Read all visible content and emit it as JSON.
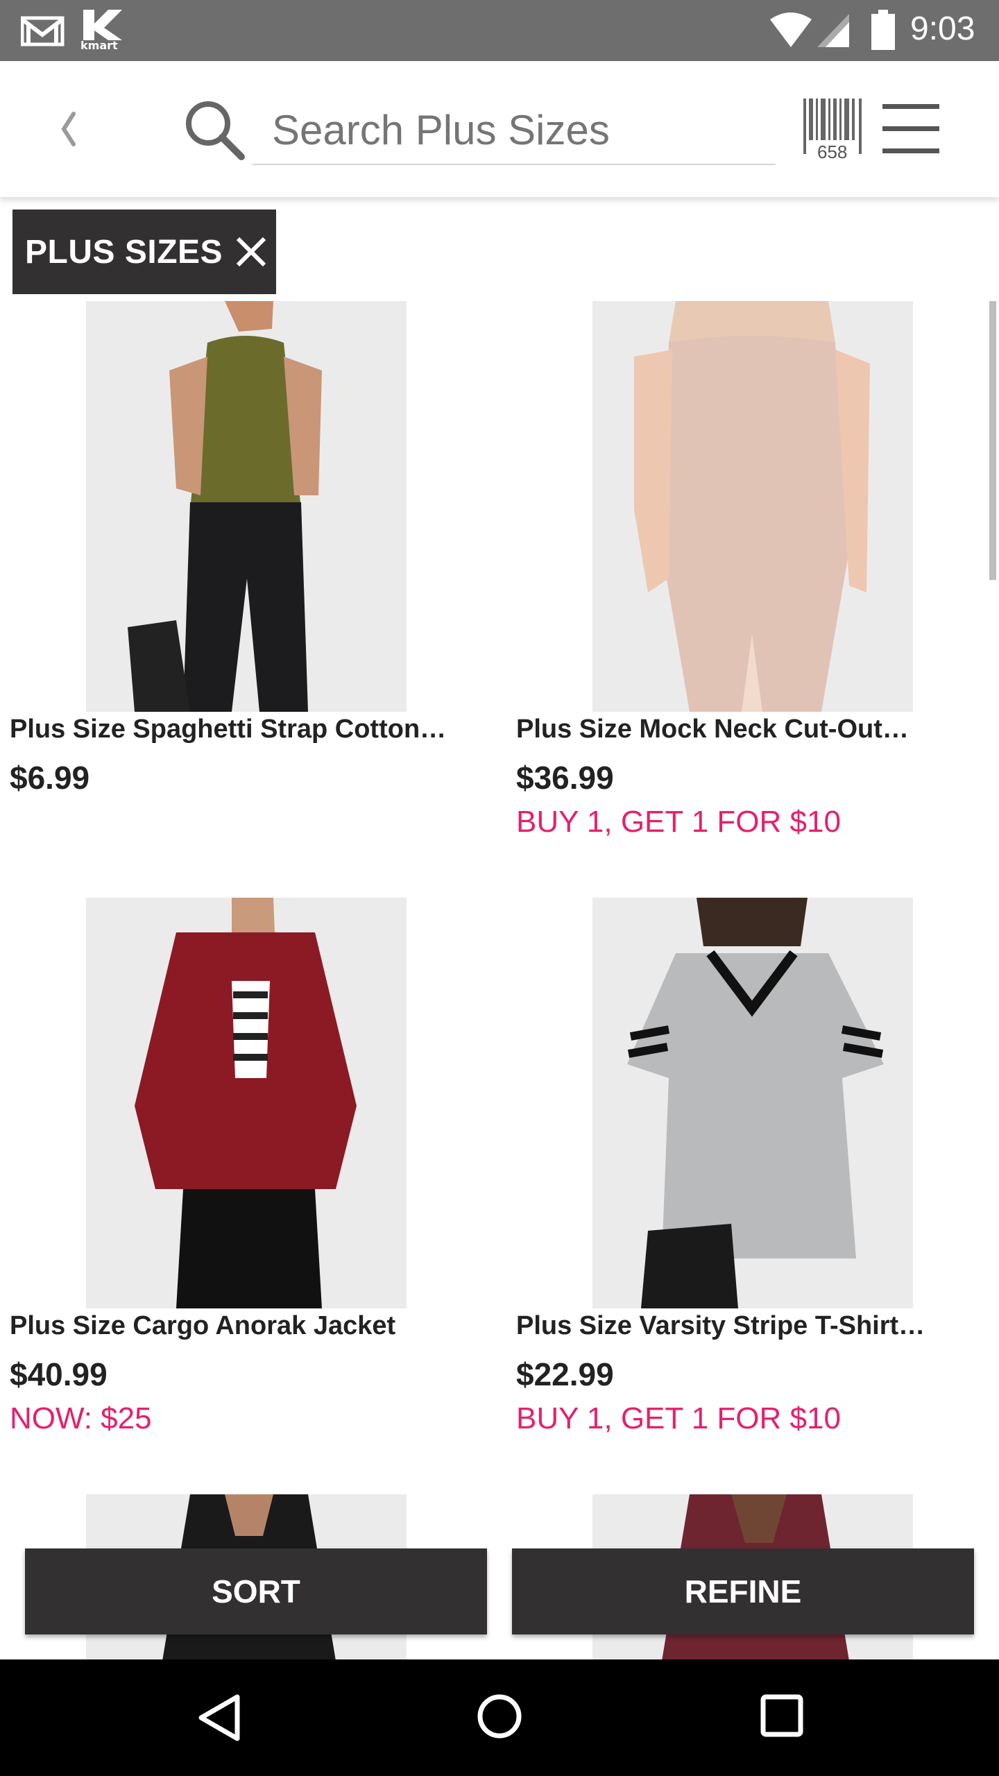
{
  "status_bar": {
    "time": "9:03",
    "app_label": "kmart",
    "icons": [
      "gmail-icon",
      "kmart-icon",
      "wifi-icon",
      "signal-icon",
      "battery-icon"
    ]
  },
  "header": {
    "search_placeholder": "Search Plus Sizes",
    "barcode_count": "658",
    "icons": [
      "back-icon",
      "search-icon",
      "barcode-icon",
      "menu-icon"
    ]
  },
  "filter": {
    "label": "PLUS SIZES"
  },
  "products": [
    {
      "name": "Plus Size Spaghetti Strap Cotton…",
      "price": "$6.99",
      "promo": ""
    },
    {
      "name": "Plus Size Mock Neck Cut-Out…",
      "price": "$36.99",
      "promo": "BUY 1, GET 1 FOR $10"
    },
    {
      "name": "Plus Size Cargo Anorak Jacket",
      "price": "$40.99",
      "promo": "NOW: $25"
    },
    {
      "name": "Plus Size Varsity Stripe T-Shirt…",
      "price": "$22.99",
      "promo": "BUY 1, GET 1 FOR $10"
    }
  ],
  "actions": {
    "sort": "SORT",
    "refine": "REFINE"
  },
  "colors": {
    "status_bar": "#6e6e6e",
    "dark_button": "#333031",
    "promo": "#e5206f"
  }
}
